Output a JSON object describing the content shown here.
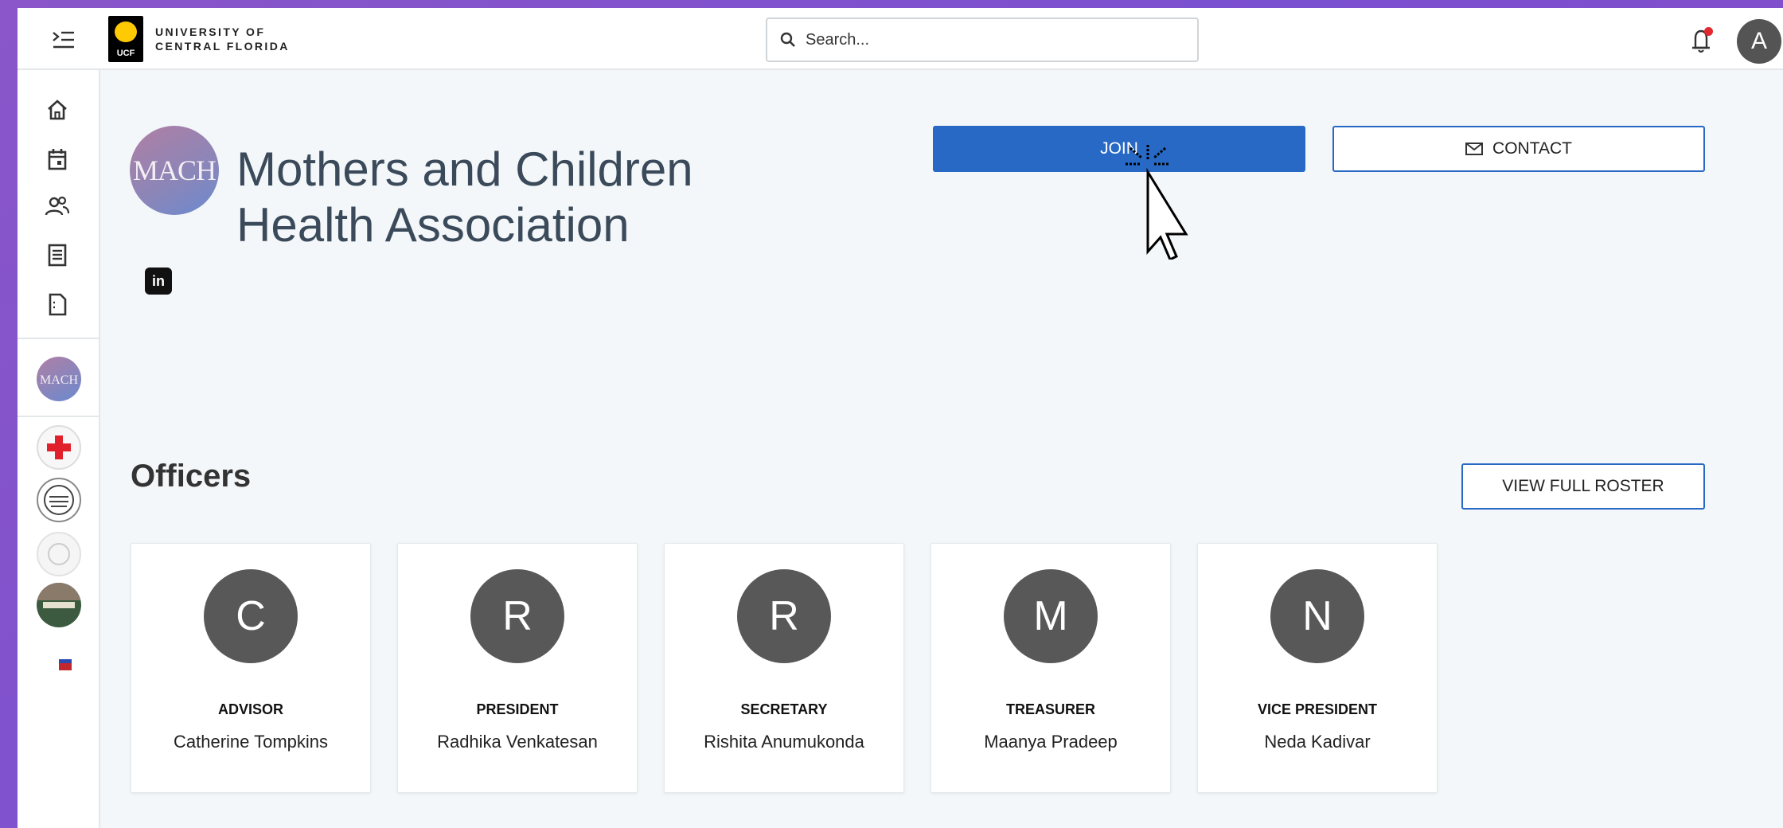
{
  "header": {
    "logo_badge": "UCF",
    "logo_line1": "UNIVERSITY OF",
    "logo_line2": "CENTRAL FLORIDA",
    "search_placeholder": "Search...",
    "user_initial": "A"
  },
  "sidebar": {
    "items": [
      {
        "icon": "home-icon"
      },
      {
        "icon": "calendar-icon"
      },
      {
        "icon": "people-icon"
      },
      {
        "icon": "document-list-icon"
      },
      {
        "icon": "forms-icon"
      }
    ]
  },
  "org": {
    "logo_text": "MACH",
    "name": "Mothers and Children Health Association",
    "social": "in"
  },
  "actions": {
    "join_label": "JOIN",
    "contact_label": "CONTACT"
  },
  "officers": {
    "title": "Officers",
    "roster_label": "VIEW FULL ROSTER",
    "list": [
      {
        "initial": "C",
        "role": "ADVISOR",
        "name": "Catherine Tompkins"
      },
      {
        "initial": "R",
        "role": "PRESIDENT",
        "name": "Radhika Venkatesan"
      },
      {
        "initial": "R",
        "role": "SECRETARY",
        "name": "Rishita Anumukonda"
      },
      {
        "initial": "M",
        "role": "TREASURER",
        "name": "Maanya Pradeep"
      },
      {
        "initial": "N",
        "role": "VICE PRESIDENT",
        "name": "Neda Kadivar"
      }
    ]
  },
  "colors": {
    "primary": "#2769c4",
    "background": "#f3f7f9",
    "avatar": "#585858",
    "notification": "#e0282e"
  }
}
